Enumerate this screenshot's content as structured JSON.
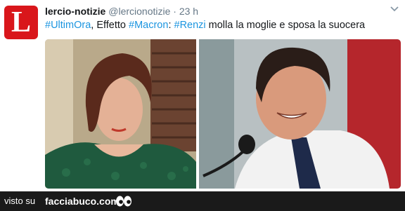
{
  "tweet": {
    "avatar_letter": "L",
    "author_name": "lercio-notizie",
    "author_handle": "@lercionotizie",
    "separator": "·",
    "timestamp": "23 h",
    "text_parts": {
      "tag1": "#UltimOra",
      "text1": ", Effetto ",
      "tag2": "#Macron",
      "text2": ": ",
      "tag3": "#Renzi",
      "text3": " molla la moglie e sposa la suocera"
    }
  },
  "footer": {
    "visto_label": "visto su",
    "site_name": "facciabuco.com"
  },
  "colors": {
    "brand_red": "#d9161b",
    "hashtag_blue": "#1b95e0",
    "footer_bg": "#1a1a1a"
  },
  "icons": {
    "menu": "chevron-down-icon",
    "footer_logo": "eyes-icon"
  }
}
